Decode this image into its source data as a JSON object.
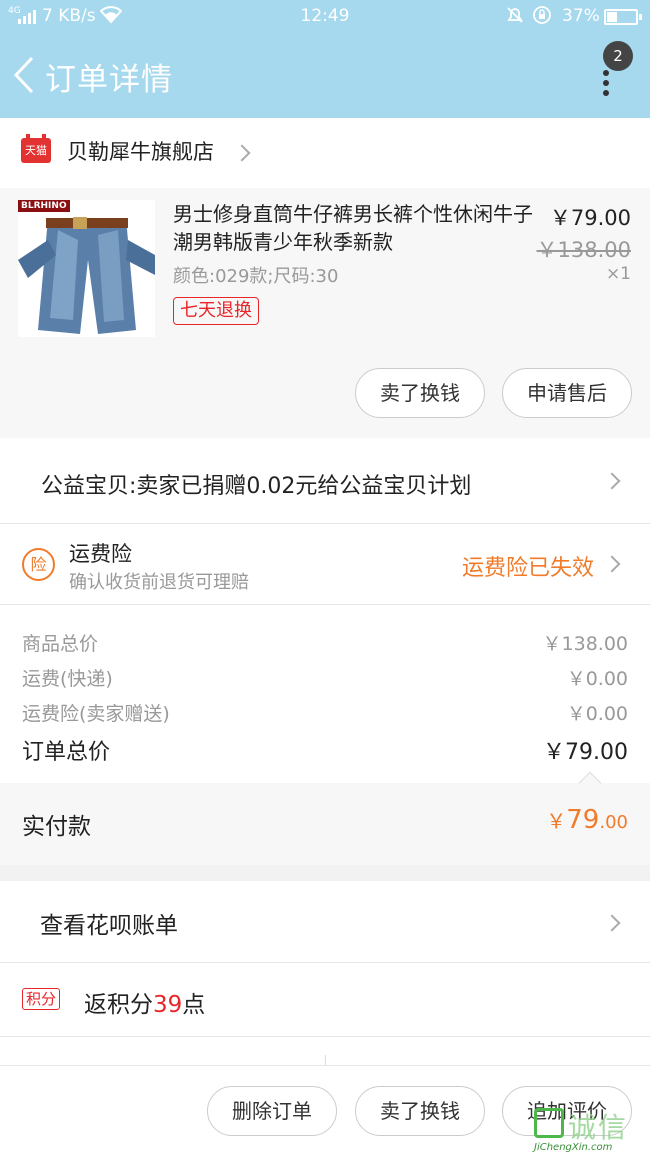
{
  "status_bar": {
    "network_type": "4G",
    "speed": "7 KB/s",
    "time": "12:49",
    "battery_percent": "37%",
    "battery_level": 0.37
  },
  "header": {
    "title": "订单详情",
    "badge_count": "2"
  },
  "shop": {
    "platform_tag": "天猫",
    "name": "贝勒犀牛旗舰店"
  },
  "product": {
    "brand_text": "BLRHINO",
    "title": "男士修身直筒牛仔裤男长裤个性休闲牛子潮男韩版青少年秋季新款",
    "spec": "颜色:029款;尺码:30",
    "return_tag": "七天退换",
    "price": "￥79.00",
    "original_price": "￥138.00",
    "quantity": "×1",
    "buttons": {
      "sell": "卖了换钱",
      "after_sale": "申请售后"
    }
  },
  "charity": {
    "text": "公益宝贝:卖家已捐赠0.02元给公益宝贝计划"
  },
  "insurance": {
    "icon_char": "险",
    "title": "运费险",
    "subtitle": "确认收货前退货可理赔",
    "status": "运费险已失效"
  },
  "summary": {
    "rows": [
      {
        "label": "商品总价",
        "value": "￥138.00"
      },
      {
        "label": "运费(快递)",
        "value": "￥0.00"
      },
      {
        "label": "运费险(卖家赠送)",
        "value": "￥0.00"
      }
    ],
    "total_label": "订单总价",
    "total_value": "￥79.00"
  },
  "paid": {
    "label": "实付款",
    "currency": "￥",
    "integer": "79",
    "decimal": ".00"
  },
  "huabei": {
    "text": "查看花呗账单"
  },
  "points": {
    "tag": "积分",
    "prefix": "返积分",
    "number": "39",
    "suffix": "点"
  },
  "bottom_buttons": {
    "delete": "删除订单",
    "sell": "卖了换钱",
    "review": "追加评价"
  },
  "watermark": {
    "text": "诚信",
    "url": "JiChengXin.com"
  },
  "colors": {
    "header_bg": "#a6d8ee",
    "accent_orange": "#f07b2a",
    "accent_red": "#e8262a",
    "tmall_red": "#e33232"
  },
  "icons": [
    "signal-icon",
    "wifi-icon",
    "mute-icon",
    "rotation-lock-icon",
    "battery-icon",
    "back-arrow-icon",
    "more-icon",
    "chevron-right-icon"
  ]
}
